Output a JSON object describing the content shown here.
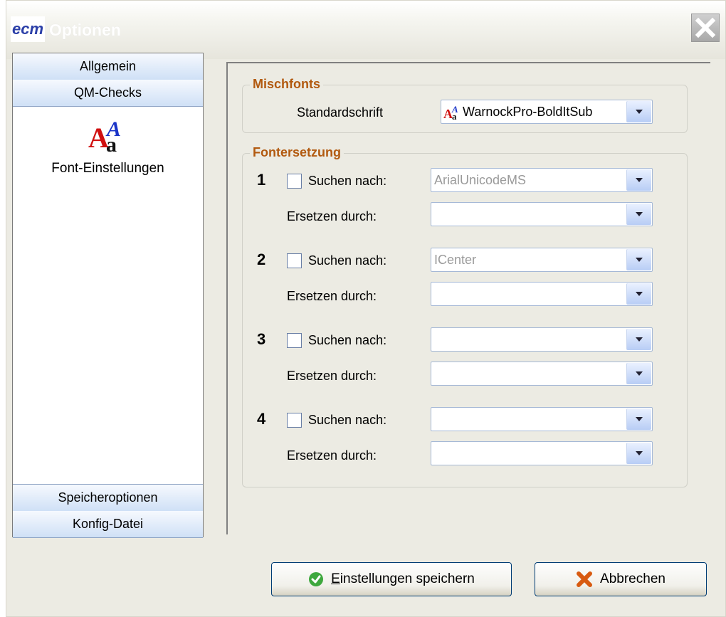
{
  "window": {
    "title": "Optionen",
    "logo_text": "ecm"
  },
  "nav": {
    "top_items": [
      {
        "label": "Allgemein"
      },
      {
        "label": "QM-Checks"
      }
    ],
    "active_item": {
      "label": "Font-Einstellungen",
      "icon": "font-icon"
    },
    "bottom_items": [
      {
        "label": "Speicheroptionen"
      },
      {
        "label": "Konfig-Datei"
      }
    ]
  },
  "mischfonts": {
    "title": "Mischfonts",
    "label": "Standardschrift",
    "value": "WarnockPro-BoldItSub"
  },
  "fontersetzung": {
    "title": "Fontersetzung",
    "rows": [
      {
        "num": "1",
        "search_label": "Suchen nach:",
        "search_value": "ArialUnicodeMS",
        "replace_label": "Ersetzen durch:",
        "replace_value": ""
      },
      {
        "num": "2",
        "search_label": "Suchen nach:",
        "search_value": "ICenter",
        "replace_label": "Ersetzen durch:",
        "replace_value": ""
      },
      {
        "num": "3",
        "search_label": "Suchen nach:",
        "search_value": "",
        "replace_label": "Ersetzen durch:",
        "replace_value": ""
      },
      {
        "num": "4",
        "search_label": "Suchen nach:",
        "search_value": "",
        "replace_label": "Ersetzen durch:",
        "replace_value": ""
      }
    ]
  },
  "buttons": {
    "save_label_underlined": "E",
    "save_label_rest": "instellungen speichern",
    "cancel_label": "Abbrechen"
  },
  "colors": {
    "group_title": "#b25a10",
    "accent_blue": "#cfe0f6"
  }
}
